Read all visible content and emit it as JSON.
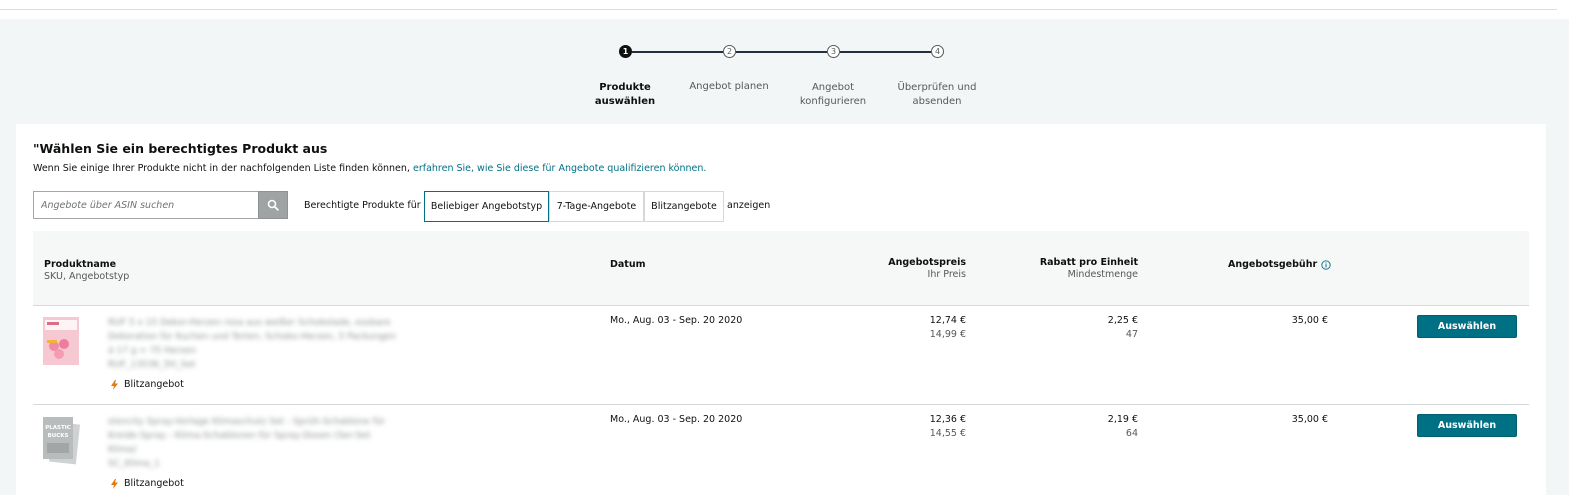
{
  "stepper": {
    "steps": [
      {
        "number": "1",
        "label": "Produkte\nauswählen",
        "active": true
      },
      {
        "number": "2",
        "label": "Angebot planen",
        "active": false
      },
      {
        "number": "3",
        "label": "Angebot\nkonfigurieren",
        "active": false
      },
      {
        "number": "4",
        "label": "Überprüfen und\nabsenden",
        "active": false
      }
    ]
  },
  "main": {
    "heading": "\"Wählen Sie ein berechtigtes Produkt aus",
    "subtext": "Wenn Sie einige Ihrer Produkte nicht in der nachfolgenden Liste finden können,",
    "subtext_link": "erfahren Sie, wie Sie diese für Angebote qualifizieren können."
  },
  "search": {
    "placeholder": "Angebote über ASIN suchen",
    "icon": "search-icon"
  },
  "filter": {
    "prefix": "Berechtigte Produkte für",
    "options": [
      "Beliebiger Angebotstyp",
      "7-Tage-Angebote",
      "Blitzangebote"
    ],
    "selected": "Beliebiger Angebotstyp",
    "suffix": "anzeigen"
  },
  "table": {
    "headers": {
      "product": "Produktname",
      "product_sub": "SKU, Angebotstyp",
      "date": "Datum",
      "price": "Angebotspreis",
      "price_sub": "Ihr Preis",
      "discount": "Rabatt pro Einheit",
      "discount_sub": "Mindestmenge",
      "fee": "Angebotsgebühr",
      "fee_icon": "info-icon"
    },
    "rows": [
      {
        "name": "RUF 5 x 15 Dekor-Herzen rosa aus weißer Schokolade, essbare Dekoration für Kuchen und Torten, Schoko-Herzen, 5 Packungen á 17 g = 75 Herzen",
        "sku": "RUF_13536_5H_Set",
        "deal_type": "Blitzangebot",
        "date": "Mo., Aug. 03 - Sep. 20 2020",
        "price": "12,74 €",
        "your_price": "14,99 €",
        "discount": "2,25 €",
        "min_qty": "47",
        "fee": "35,00 €",
        "button": "Auswählen"
      },
      {
        "name": "stencity Spray-Vorlage Klimaschutz Set - Sprüh-Schablone für Kreide-Spray - Klima-Schablonen für Spray-Dosen (Ser-Set Klima)",
        "sku": "SC_Klima_1",
        "deal_type": "Blitzangebot",
        "date": "Mo., Aug. 03 - Sep. 20 2020",
        "price": "12,36 €",
        "your_price": "14,55 €",
        "discount": "2,19 €",
        "min_qty": "64",
        "fee": "35,00 €",
        "button": "Auswählen",
        "thumb_text": "PLASTIC\nBUCKS"
      }
    ]
  },
  "colors": {
    "accent": "#007185",
    "stepper_active": "#0f1111",
    "deal_icon": "#e47911"
  }
}
